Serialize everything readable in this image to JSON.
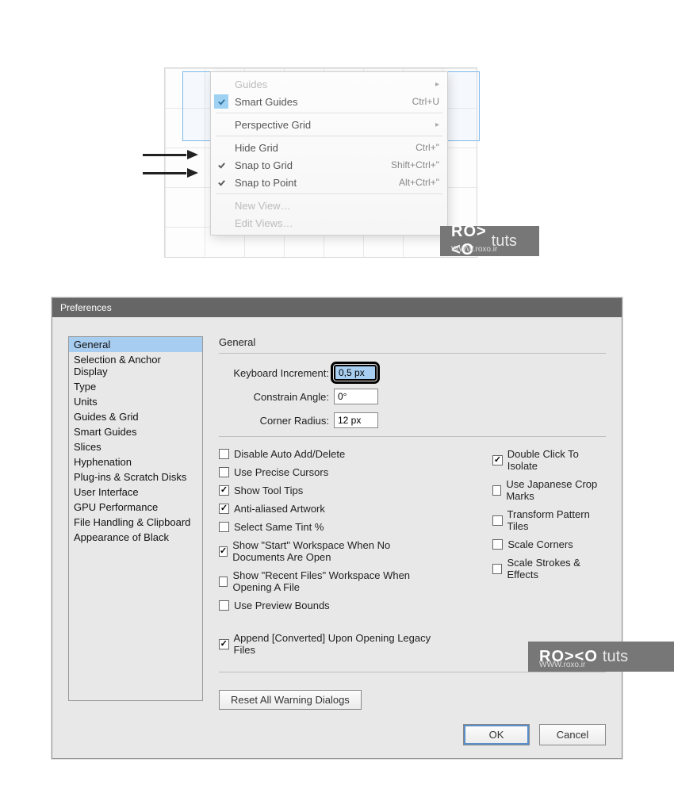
{
  "menu": {
    "guides": "Guides",
    "smart_guides": "Smart Guides",
    "smart_guides_key": "Ctrl+U",
    "perspective": "Perspective Grid",
    "hide_grid": "Hide Grid",
    "hide_grid_key": "Ctrl+\"",
    "snap_grid": "Snap to Grid",
    "snap_grid_key": "Shift+Ctrl+\"",
    "snap_point": "Snap to Point",
    "snap_point_key": "Alt+Ctrl+\"",
    "new_view": "New View…",
    "edit_views": "Edit Views…"
  },
  "brand": {
    "logo": "RO><O",
    "tuts": "tuts",
    "url": "WWW.roxo.ir"
  },
  "dialog": {
    "title": "Preferences",
    "sections": [
      "General",
      "Selection & Anchor Display",
      "Type",
      "Units",
      "Guides & Grid",
      "Smart Guides",
      "Slices",
      "Hyphenation",
      "Plug-ins & Scratch Disks",
      "User Interface",
      "GPU Performance",
      "File Handling & Clipboard",
      "Appearance of Black"
    ],
    "heading": "General",
    "fields": {
      "keyboard_increment_label": "Keyboard Increment:",
      "keyboard_increment_value": "0,5 px",
      "constrain_angle_label": "Constrain Angle:",
      "constrain_angle_value": "0°",
      "corner_radius_label": "Corner Radius:",
      "corner_radius_value": "12 px"
    },
    "checks_left": [
      {
        "label": "Disable Auto Add/Delete",
        "checked": false
      },
      {
        "label": "Use Precise Cursors",
        "checked": false
      },
      {
        "label": "Show Tool Tips",
        "checked": true
      },
      {
        "label": "Anti-aliased Artwork",
        "checked": true
      },
      {
        "label": "Select Same Tint %",
        "checked": false
      },
      {
        "label": "Show \"Start\" Workspace When No Documents Are Open",
        "checked": true
      },
      {
        "label": "Show \"Recent Files\" Workspace When Opening A File",
        "checked": false
      },
      {
        "label": "Use Preview Bounds",
        "checked": false
      },
      {
        "label": "Append [Converted] Upon Opening Legacy Files",
        "checked": true
      }
    ],
    "checks_right": [
      {
        "label": "Double Click To Isolate",
        "checked": true
      },
      {
        "label": "Use Japanese Crop Marks",
        "checked": false
      },
      {
        "label": "Transform Pattern Tiles",
        "checked": false
      },
      {
        "label": "Scale Corners",
        "checked": false
      },
      {
        "label": "Scale Strokes & Effects",
        "checked": false
      }
    ],
    "reset_btn": "Reset All Warning Dialogs",
    "ok": "OK",
    "cancel": "Cancel"
  }
}
